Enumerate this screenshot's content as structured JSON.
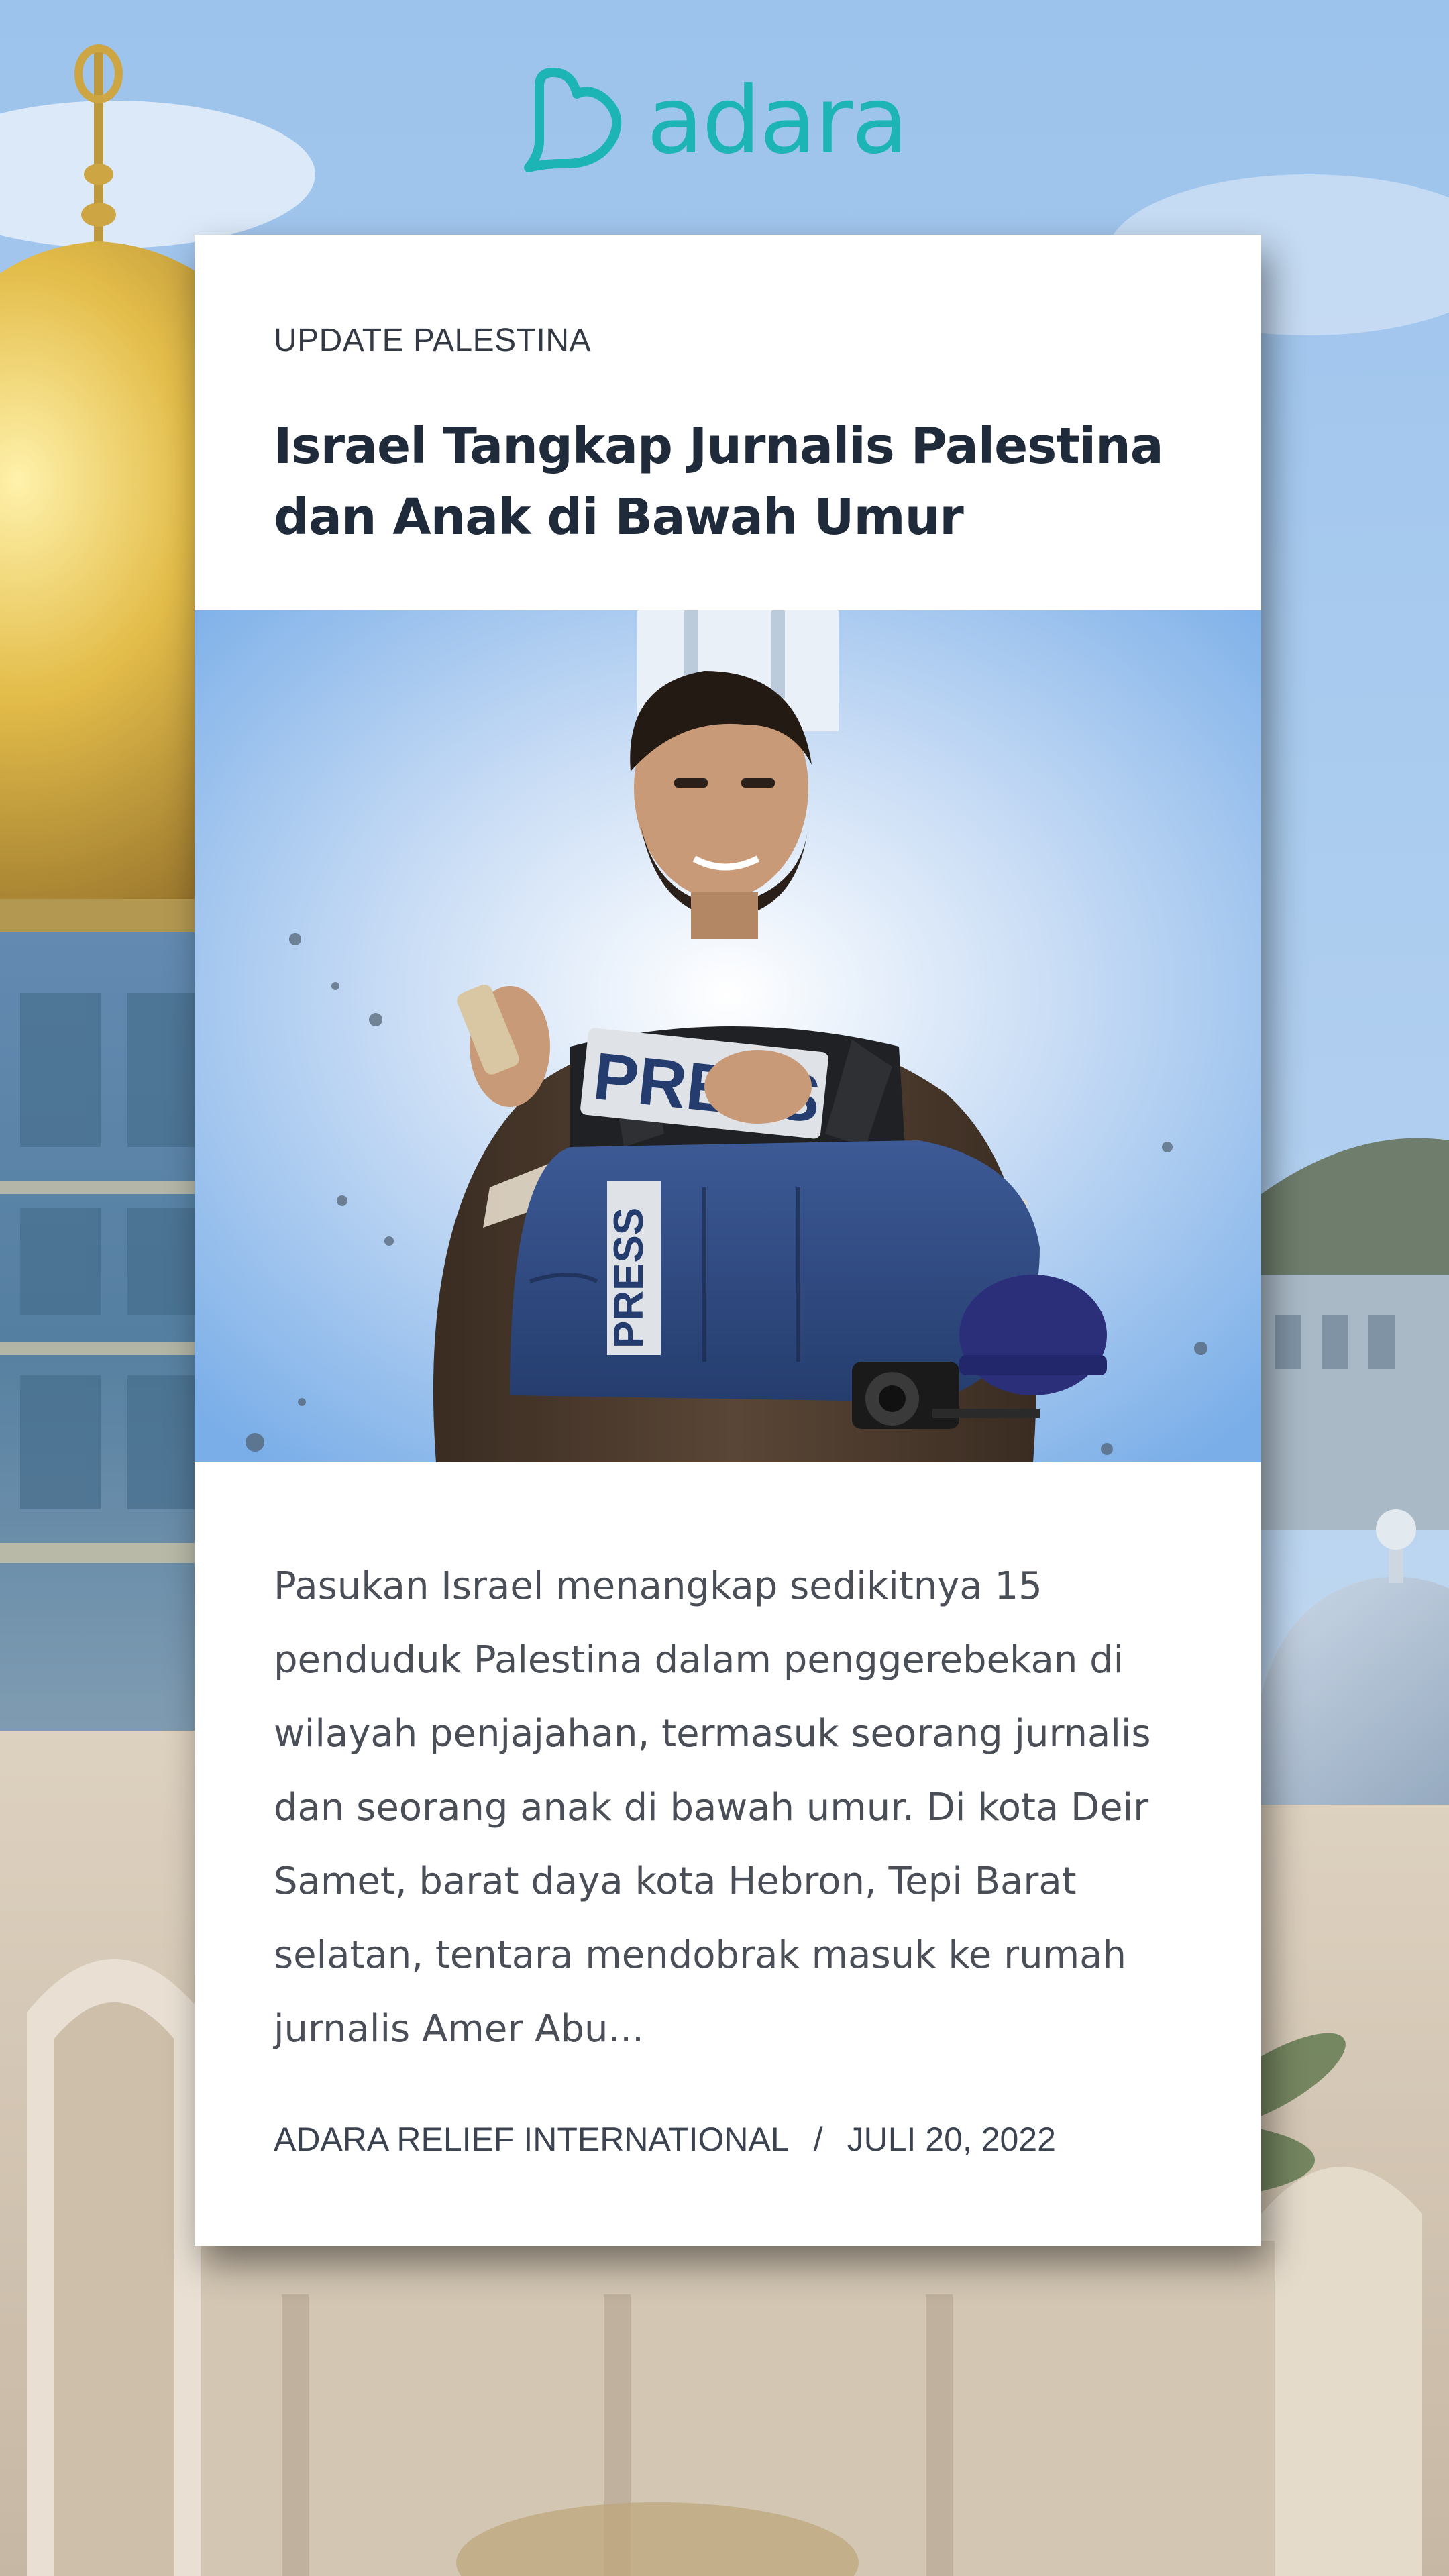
{
  "brand": {
    "name": "adara",
    "logo_icon": "adara-heart-chat-icon",
    "color": "#1cb4b4"
  },
  "article": {
    "category": "UPDATE PALESTINA",
    "title": "Israel Tangkap Jurnalis Palestina dan Anak di Bawah Umur",
    "image_icon": "journalist-photo",
    "image_press_label": "PRESS",
    "excerpt": "Pasukan Israel menangkap sedikitnya 15 penduduk Palestina dalam penggerebekan di wilayah penjajahan, termasuk seorang jurnalis dan seorang anak di bawah umur. Di kota Deir Samet, barat daya kota Hebron, Tepi Barat selatan, tentara mendobrak masuk ke rumah jurnalis Amer Abu...",
    "author": "ADARA RELIEF INTERNATIONAL",
    "separator": "/",
    "date": "JULI 20, 2022"
  },
  "colors": {
    "card_background": "#ffffff",
    "title": "#1f2a3a",
    "text": "#4a4f57",
    "sky": "#7fb1e6"
  }
}
